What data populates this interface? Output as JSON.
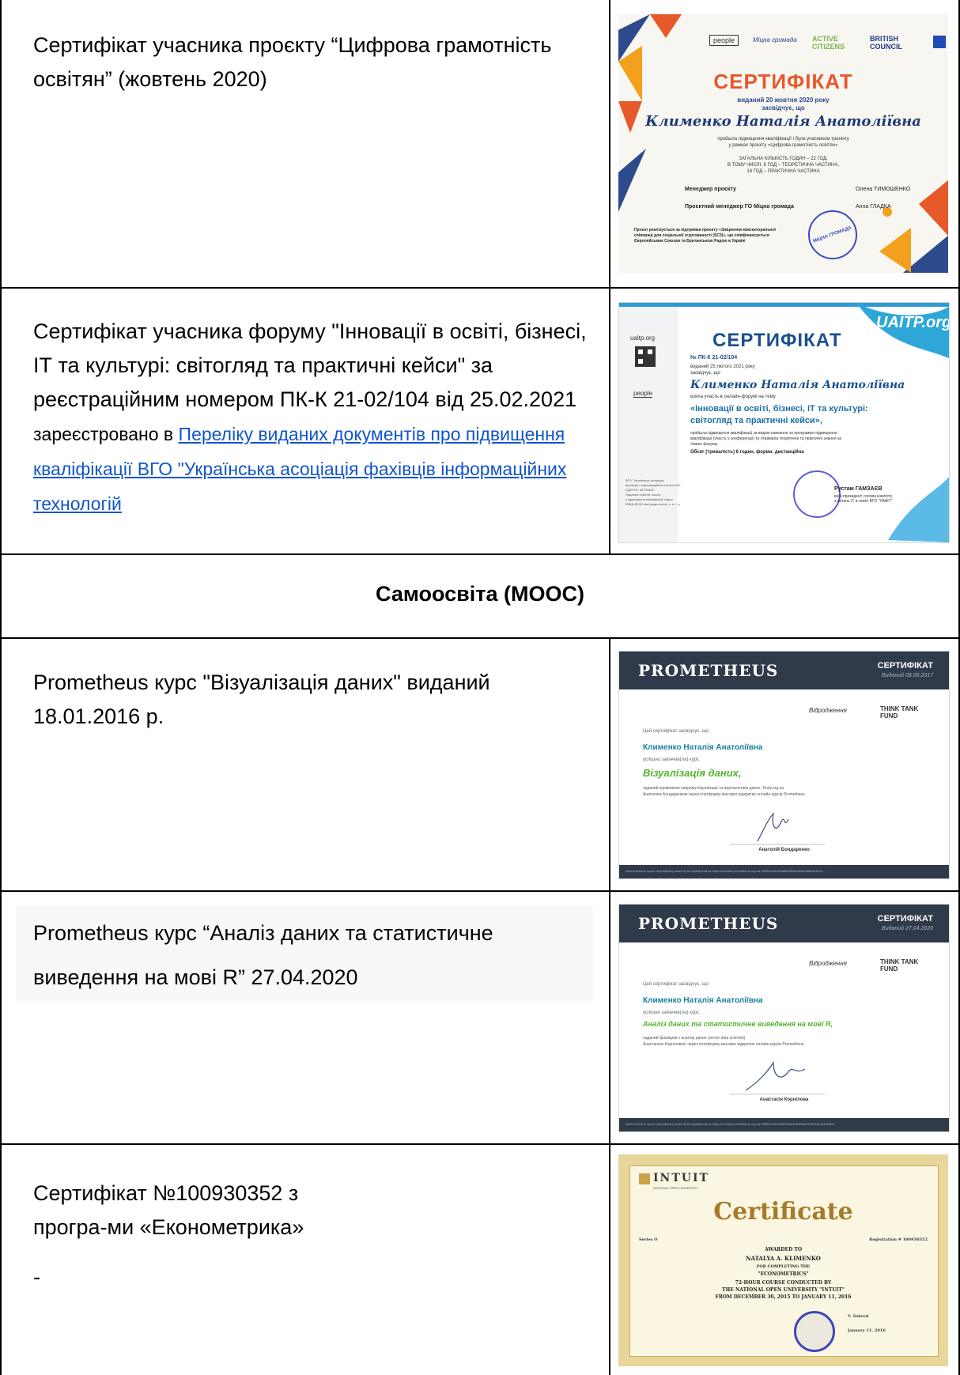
{
  "rows": [
    {
      "text": "Сертифікат учасника проєкту “Цифрова грамотність освітян” (жовтень 2020)",
      "certificate": {
        "logos": [
          "people",
          "Міцна громада",
          "ACTIVE CITIZENS",
          "BRITISH COUNCIL"
        ],
        "title": "СЕРТИФІКАТ",
        "issued": "виданий 20 жовтня 2020 року",
        "certifies": "засвідчує, що",
        "name": "Клименко Наталія Анатоліївна",
        "body1": "пройшла підвищення кваліфікації і була учасником тренінгу",
        "body2": "у рамках проєкту «Цифрова грамотність освітян»",
        "hours1": "ЗАГАЛЬНА КІЛЬКІСТЬ ГОДИН – 22 ГОД,",
        "hours2": "В ТОМУ ЧИСЛІ: 8 ГОД – ТЕОРЕТИЧНА ЧАСТИНА,",
        "hours3": "14 ГОД – ПРАКТИЧНА ЧАСТИНА",
        "role1": "Менеджер проєкту",
        "person1": "Олена ТИМОШЕНКО",
        "role2": "Проєктний менеджер ГО Міцна громада",
        "person2": "Анна ГЛАДКА",
        "foot1": "Проєкт реалізується за підтримки проєкту «Зміцнення міжсекторальної",
        "foot2": "співпраці для соціальної згуртованості (SC3)», що співфінансується",
        "foot3": "Європейським Союзом та Британською Радою в Україні",
        "seal": "МІЦНА ГРОМАДА"
      }
    },
    {
      "text1": "Сертифікат учасника форуму \"Інновації в освіті, бізнесі, ІТ та культурі: світогляд та практичні кейси\" за реєстраційним номером ПК-К 21-02/104 від 25.02.2021",
      "text2": "зареєстровано в ",
      "link": "Переліку виданих документів про підвищення кваліфікації ВГО \"Українська асоціація фахівців інформаційних технологій",
      "certificate": {
        "site": "uaitp.org",
        "logo": "UAITP.org",
        "title": "СЕРТИФІКАТ",
        "number": "№ ПК-К 21-02/104",
        "issued": "виданий 25 лютого 2021 року",
        "certifies": "засвідчує, що",
        "name": "Клименко Наталія Анатоліївна",
        "took": "взяла участь в онлайн-форумі на тему",
        "topic1": "«Інновації в освіті, бізнесі, ІТ та культурі:",
        "topic2": "світогляд та практичні кейси»,",
        "b1": "пройшла підвищення кваліфікації за видом навчання за програмою підвищення",
        "b2": "кваліфікації (участь у конференції) та отримала теоретичні та практичні знання за",
        "b3": "темою форуму.",
        "volume": "Обсяг (тривалість) 6 годин, форма: дистанційна",
        "org1": "ВГО \"Українська асоціація",
        "org2": "фахівців з інформаційних технологій\"",
        "org3": "ЄДРПОУ 35701828",
        "org4": "Надання освітніх послуг",
        "org5": "з підвищення кваліфікації згідно",
        "org6": "КВЕД 85.59 Інші види освіти, н. в. і. у.",
        "signer": "Рустам ГАМЗАЄВ",
        "signer_role1": "віце-президент, голова комітету",
        "signer_role2": "з питань ІТ в освіті ВГО \"УАФІТ\"",
        "people": "people"
      }
    },
    {
      "heading": "Самоосвіта (MOOC)"
    },
    {
      "text": "Prometheus курс \"Візуалізація даних\" виданий 18.01.2016 р.",
      "certificate": {
        "brand": "PROMETHEUS",
        "title": "СЕРТИФІКАТ",
        "date": "Виданий 06.06.2017",
        "certifies": "Цей сертифікат засвідчує, що",
        "name": "Клименко Наталія Анатоліївна",
        "completed": "успішно закінчив(ла) курс",
        "course": "Візуалізація даних,",
        "b1": "наданий керівником напряму візуалізації та журналістики даних, Texty.org.ua",
        "b2": "Анатолієм Бондаренком через платформу масових відкритих онлайн-курсів Prometheus.",
        "signer": "Анатолій Бондаренко",
        "partners": [
          "Відродження",
          "THINK TANK FUND"
        ],
        "footer": "Автентичність цього сертифікату може бути перевірена за https://courses.prometheus.org.ua:18090/cert/c50a8fa092664f0ab3384d61b20..."
      }
    },
    {
      "text": "Prometheus курс “Аналіз даних та статистичне виведення на мові R” 27.04.2020",
      "certificate": {
        "brand": "PROMETHEUS",
        "title": "СЕРТИФІКАТ",
        "date": "Виданий 27.04.2020",
        "certifies": "Цей сертифікат засвідчує, що",
        "name": "Клименко Наталія Анатоліївна",
        "completed": "успішно закінчив(ла) курс",
        "course": "Аналіз даних та статистичне виведення на мові R,",
        "b1": "наданий фахівцем з аналізу даних (senior data scientist)",
        "b2": "Анастасією Корніловою через платформу масових відкритих онлайн-курсів Prometheus.",
        "signer": "Анастасія Корнілова",
        "partners": [
          "Відродження",
          "THINK TANK FUND"
        ],
        "footer": "Автентичність цього сертифікату може бути перевірена за https://courses.prometheus.org.ua:18090/cert/b1ba4916d4b6f46a6975624a1da1b8fde1"
      }
    },
    {
      "text1": "Сертифікат №100930352 з",
      "text2": "програ-ми «Економетрика»",
      "text3": "-",
      "certificate": {
        "brand": "INTUIT",
        "brand_sub": "NATIONAL OPEN UNIVERSITY",
        "title": "Certificate",
        "series": "Series O",
        "registration": "Registration # 100930352",
        "l1": "AWARDED TO",
        "l2": "NATALYA A. KLIMENKO",
        "l3": "FOR COMPLETING THE",
        "l4": "\"ECONOMETRICS\"",
        "l5": "72-HOUR COURSE CONDUCTED BY",
        "l6": "THE NATIONAL OPEN UNIVERSITY \"INTUIT\"",
        "l7": "FROM DECEMBER 30, 2015 TO JANUARY 11, 2016",
        "signer": "V. Sokred",
        "date": "January 11, 2016"
      }
    }
  ]
}
